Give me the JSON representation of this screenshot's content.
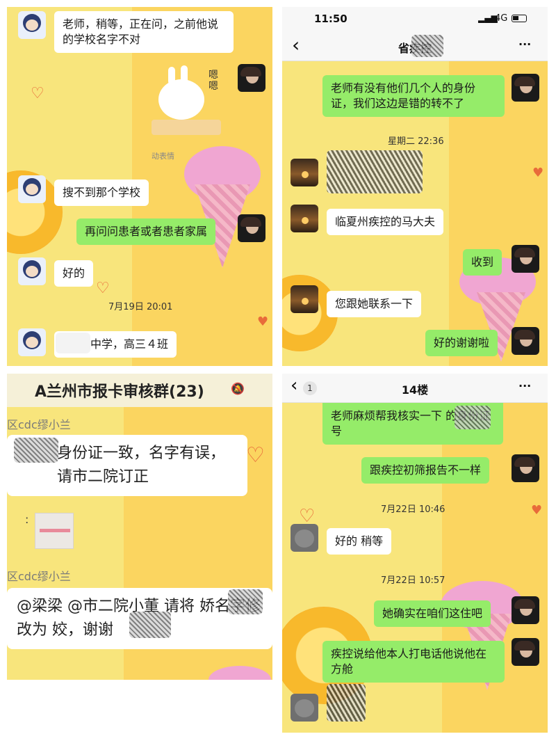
{
  "panel1": {
    "messages": [
      {
        "text": "老师，稍等，正在问，之前他说的学校名字不对"
      },
      {
        "text": "搜不到那个学校"
      },
      {
        "text": "再问问患者或者患者家属"
      },
      {
        "text": "好的"
      },
      {
        "text": "中学，高三４班"
      }
    ],
    "sticker_text": "嗯嗯",
    "sticker_caption": "动表情",
    "timestamp": "7月19日 20:01"
  },
  "panel2": {
    "status": {
      "time": "11:50",
      "network": "4G"
    },
    "nav": {
      "back_icon": "‹",
      "title": "省疾控",
      "more_icon": "···"
    },
    "messages": [
      {
        "text": "老师有没有他们几个人的身份证，我们这边是错的转不了"
      },
      {
        "text": "临夏州疾控的马大夫"
      },
      {
        "text": "收到"
      },
      {
        "text": "您跟她联系一下"
      },
      {
        "text": "好的谢谢啦"
      }
    ],
    "timestamp": "星期二 22:36"
  },
  "panel3": {
    "header_title": "A兰州市报卡审核群(23)",
    "mute_icon": "🔕",
    "sender1": "区cdc缪小兰",
    "message1": "身份证一致，名字有误，请市二院订正",
    "attachment_label": ":",
    "sender2": "区cdc缪小兰",
    "message2": "@梁梁 @市二院小董 请将 娇名字修改为 姣，谢谢"
  },
  "panel4": {
    "nav": {
      "back_icon": "‹",
      "badge": "1",
      "title": "14楼",
      "more_icon": "···"
    },
    "messages": [
      {
        "text": "老师麻烦帮我核实一下 的身份证号"
      },
      {
        "text": "跟疾控初筛报告不一样"
      },
      {
        "text": "好的 稍等"
      },
      {
        "text": "她确实在咱们这住吧"
      },
      {
        "text": "疾控说给他本人打电话他说他在方舱"
      }
    ],
    "timestamps": [
      "7月22日 10:46",
      "7月22日 10:57"
    ]
  }
}
